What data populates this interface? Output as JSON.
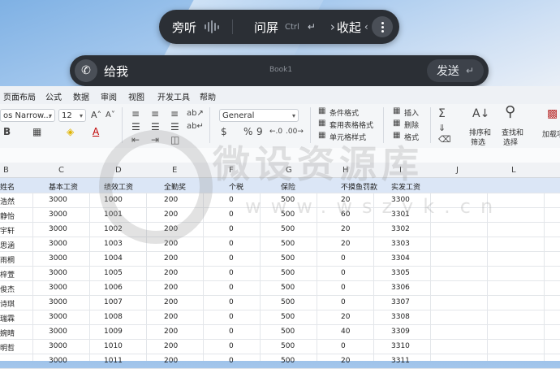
{
  "voice_bar": {
    "listen_label": "旁听",
    "ask_label": "问屏",
    "ask_shortcut": "Ctrl",
    "enter_symbol": "↵",
    "collapse_label": "收起",
    "collapse_prefix": "›",
    "collapse_chevron": "‹"
  },
  "input_bar": {
    "text": "给我",
    "doc_title": "Book1",
    "send_label": "发送",
    "send_symbol": "↵"
  },
  "menu": [
    "页面布局",
    "公式",
    "数据",
    "审阅",
    "视图",
    "开发工具",
    "帮助"
  ],
  "ribbon": {
    "font_name": "os Narrow...",
    "font_size": "12",
    "number_format": "General",
    "conditional_format": "条件格式",
    "table_format": "套用表格格式",
    "cell_style": "单元格样式",
    "insert": "插入",
    "delete": "删除",
    "format": "格式",
    "sort_filter": [
      "排序和",
      "筛选"
    ],
    "find_select": [
      "查找和",
      "选择"
    ],
    "addins": "加载项",
    "currency": "$",
    "percent": "%",
    "comma": "9"
  },
  "columns": [
    "B",
    "C",
    "D",
    "E",
    "F",
    "G",
    "H",
    "I",
    "J",
    "L"
  ],
  "table": {
    "headers": [
      "姓名",
      "基本工资",
      "绩效工资",
      "全勤奖",
      "个税",
      "保险",
      "不摸鱼罚款",
      "实发工资"
    ],
    "rows": [
      [
        "浩然",
        "3000",
        "1000",
        "200",
        "0",
        "500",
        "20",
        "3300"
      ],
      [
        "静怡",
        "3000",
        "1001",
        "200",
        "0",
        "500",
        "60",
        "3301"
      ],
      [
        "宇轩",
        "3000",
        "1002",
        "200",
        "0",
        "500",
        "20",
        "3302"
      ],
      [
        "思涵",
        "3000",
        "1003",
        "200",
        "0",
        "500",
        "20",
        "3303"
      ],
      [
        "雨桐",
        "3000",
        "1004",
        "200",
        "0",
        "500",
        "0",
        "3304"
      ],
      [
        "梓萱",
        "3000",
        "1005",
        "200",
        "0",
        "500",
        "0",
        "3305"
      ],
      [
        "俊杰",
        "3000",
        "1006",
        "200",
        "0",
        "500",
        "0",
        "3306"
      ],
      [
        "诗琪",
        "3000",
        "1007",
        "200",
        "0",
        "500",
        "0",
        "3307"
      ],
      [
        "瑞霖",
        "3000",
        "1008",
        "200",
        "0",
        "500",
        "20",
        "3308"
      ],
      [
        "婉晴",
        "3000",
        "1009",
        "200",
        "0",
        "500",
        "40",
        "3309"
      ],
      [
        "明哲",
        "3000",
        "1010",
        "200",
        "0",
        "500",
        "0",
        "3310"
      ],
      [
        "",
        "3000",
        "1011",
        "200",
        "0",
        "500",
        "20",
        "3311"
      ]
    ]
  },
  "watermark": {
    "text": "微设资源库",
    "url": "www.wszyk.cn"
  },
  "colors": {
    "bar_bg": "#2b2f35",
    "header_row_bg": "#dbe6f6",
    "ribbon_bg": "#f4f6f8"
  }
}
